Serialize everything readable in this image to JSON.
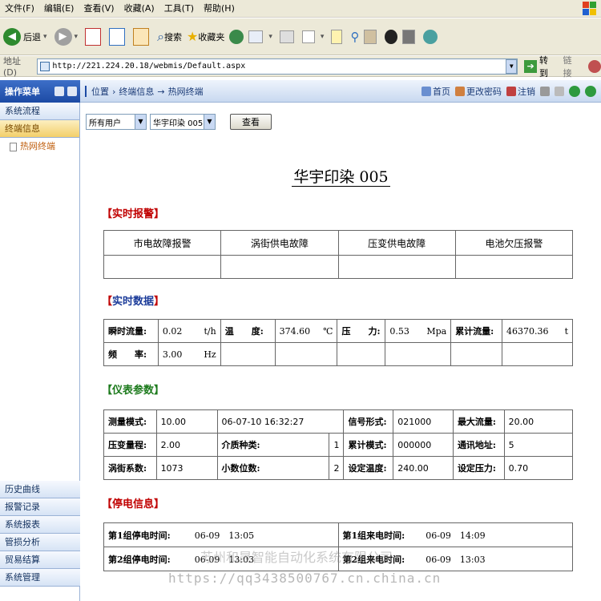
{
  "menubar": [
    "文件(F)",
    "编辑(E)",
    "查看(V)",
    "收藏(A)",
    "工具(T)",
    "帮助(H)"
  ],
  "toolbar": {
    "back": "后退",
    "search": "搜索",
    "favorites": "收藏夹"
  },
  "address": {
    "label": "地址(D)",
    "url": "http://221.224.20.18/webmis/Default.aspx",
    "go": "转到",
    "links": "链接"
  },
  "app": {
    "menu_title": "操作菜单",
    "breadcrumb": [
      "位置",
      "终端信息",
      "热网终端"
    ],
    "header_links": [
      "首页",
      "更改密码",
      "注销"
    ]
  },
  "sidebar": {
    "top": [
      "系统流程",
      "终端信息"
    ],
    "sub": [
      "热网终端"
    ],
    "bottom": [
      "历史曲线",
      "报警记录",
      "系统报表",
      "管损分析",
      "贸易结算",
      "系统管理"
    ]
  },
  "filter": {
    "user": "所有用户",
    "terminal": "华宇印染 005",
    "query": "查看"
  },
  "title": "华宇印染 005",
  "sections": {
    "alarm": "实时报警",
    "data": "实时数据",
    "params": "仪表参数",
    "power": "停电信息"
  },
  "alarm_headers": [
    "市电故障报警",
    "涡街供电故障",
    "压变供电故障",
    "电池欠压报警"
  ],
  "realtime": {
    "r1": [
      {
        "label": "瞬时流量:",
        "value": "0.02",
        "unit": "t/h"
      },
      {
        "label": "温　　度:",
        "value": "374.60",
        "unit": "℃"
      },
      {
        "label": "压　　力:",
        "value": "0.53",
        "unit": "Mpa"
      },
      {
        "label": "累计流量:",
        "value": "46370.36",
        "unit": "t"
      }
    ],
    "r2": {
      "label": "频　　率:",
      "value": "3.00",
      "unit": "Hz"
    }
  },
  "params": [
    [
      {
        "label": "测量模式:",
        "value": "10.00"
      },
      {
        "label": "06-07-10 16:32:27",
        "value": ""
      },
      {
        "label": "信号形式:",
        "value": "021000"
      },
      {
        "label": "最大流量:",
        "value": "20.00"
      }
    ],
    [
      {
        "label": "压变量程:",
        "value": "2.00"
      },
      {
        "label": "介质种类:",
        "value": "1"
      },
      {
        "label": "累计模式:",
        "value": "000000"
      },
      {
        "label": "通讯地址:",
        "value": "5"
      }
    ],
    [
      {
        "label": "涡街系数:",
        "value": "1073"
      },
      {
        "label": "小数位数:",
        "value": "2"
      },
      {
        "label": "设定温度:",
        "value": "240.00"
      },
      {
        "label": "设定压力:",
        "value": "0.70"
      }
    ]
  ],
  "power": [
    [
      {
        "label": "第1组停电时间:",
        "value": "06-09　13:05"
      },
      {
        "label": "第1组来电时间:",
        "value": "06-09　14:09"
      }
    ],
    [
      {
        "label": "第2组停电时间:",
        "value": "06-09　13:03"
      },
      {
        "label": "第2组来电时间:",
        "value": "06-09　13:03"
      }
    ]
  ],
  "watermark": "https://qq3438500767.cn.china.cn",
  "watermark2": "苏州和晟智能自动化系统有限公司"
}
